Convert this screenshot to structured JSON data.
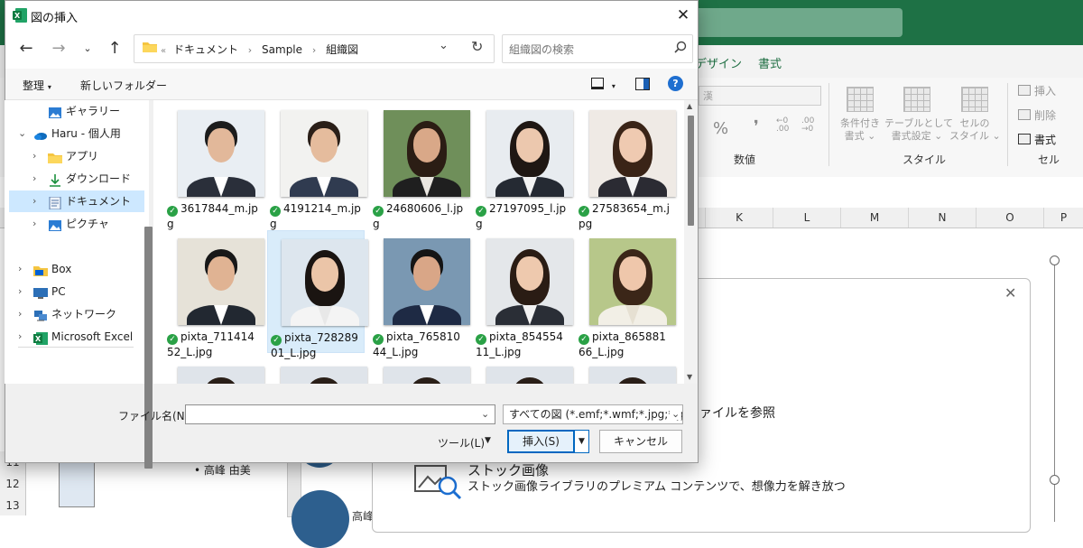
{
  "excel": {
    "tabs": [
      "デザイン",
      "書式"
    ],
    "ribbon": {
      "font_box": "漢",
      "group_number": "数値",
      "group_style": "スタイル",
      "group_cell": "セル",
      "percent": "%",
      "comma": "❜",
      "dec_inc": "←0\n.00",
      "dec_dec": ".00\n→0",
      "conditional_format": "条件付き\n書式 ⌄",
      "table_format": "テーブルとして\n書式設定 ⌄",
      "cell_style": "セルの\nスタイル ⌄",
      "insert": "挿入",
      "delete": "削除",
      "format": "書式"
    },
    "columns": [
      "K",
      "L",
      "M",
      "N",
      "O",
      "P"
    ],
    "rows": [
      "11",
      "12",
      "13"
    ],
    "smartart": {
      "bullet_text": "•  高峰 由美",
      "right_text": "高峰"
    },
    "panel": {
      "file_text": "ァイルを参照",
      "stock_title": "ストック画像",
      "stock_sub": "ストック画像ライブラリのプレミアム コンテンツで、想像力を解き放つ"
    },
    "colors": {
      "accent": "#1e7145"
    }
  },
  "dialog": {
    "title": "図の挿入",
    "address": {
      "overflow": "«",
      "parts": [
        "ドキュメント",
        "Sample",
        "組織図"
      ],
      "separator": "›"
    },
    "search_placeholder": "組織図の検索",
    "toolbar": {
      "organize": "整理",
      "organize_chev": "▾",
      "new_folder": "新しいフォルダー",
      "view_chev": "▾",
      "help": "?"
    },
    "nav_items": [
      {
        "label": "ギャラリー",
        "icon": "gallery-icon",
        "expandable": false,
        "indent": 1
      },
      {
        "label": "Haru - 個人用",
        "icon": "onedrive-icon",
        "expandable": true,
        "expanded": true,
        "indent": 0
      },
      {
        "label": "アプリ",
        "icon": "folder-icon",
        "expandable": true,
        "indent": 1
      },
      {
        "label": "ダウンロード",
        "icon": "download-icon",
        "expandable": true,
        "indent": 1
      },
      {
        "label": "ドキュメント",
        "icon": "documents-icon",
        "expandable": true,
        "indent": 1,
        "selected": true
      },
      {
        "label": "ピクチャ",
        "icon": "pictures-icon",
        "expandable": true,
        "indent": 1
      },
      {
        "label": "Box",
        "icon": "box-icon",
        "expandable": true,
        "indent": 0
      },
      {
        "label": "PC",
        "icon": "pc-icon",
        "expandable": true,
        "indent": 0
      },
      {
        "label": "ネットワーク",
        "icon": "network-icon",
        "expandable": true,
        "indent": 0
      },
      {
        "label": "Microsoft Excel",
        "icon": "excel-icon",
        "expandable": true,
        "indent": 0
      }
    ],
    "files": [
      {
        "name": "3617844_m.jpg",
        "status": "✓"
      },
      {
        "name": "4191214_m.jpg",
        "status": "✓"
      },
      {
        "name": "24680606_l.jpg",
        "status": "✓"
      },
      {
        "name": "27197095_l.jpg",
        "status": "✓"
      },
      {
        "name": "27583654_m.jpg",
        "status": "✓"
      },
      {
        "name": "pixta_71141452_L.jpg",
        "status": "✓"
      },
      {
        "name": "pixta_72828901_L.jpg",
        "status": "✓",
        "selected": true
      },
      {
        "name": "pixta_76581044_L.jpg",
        "status": "✓"
      },
      {
        "name": "pixta_85455411_L.jpg",
        "status": "✓"
      },
      {
        "name": "pixta_86588166_L.jpg",
        "status": "✓"
      }
    ],
    "filename_label": "ファイル名(N):",
    "filename_value": "",
    "filetype": "すべての図 (*.emf;*.wmf;*.jpg;*.jpeg;*.jfif;*.jpe;*.png)",
    "tools_label": "ツール(L)",
    "insert_label": "挿入(S)",
    "cancel_label": "キャンセル"
  }
}
